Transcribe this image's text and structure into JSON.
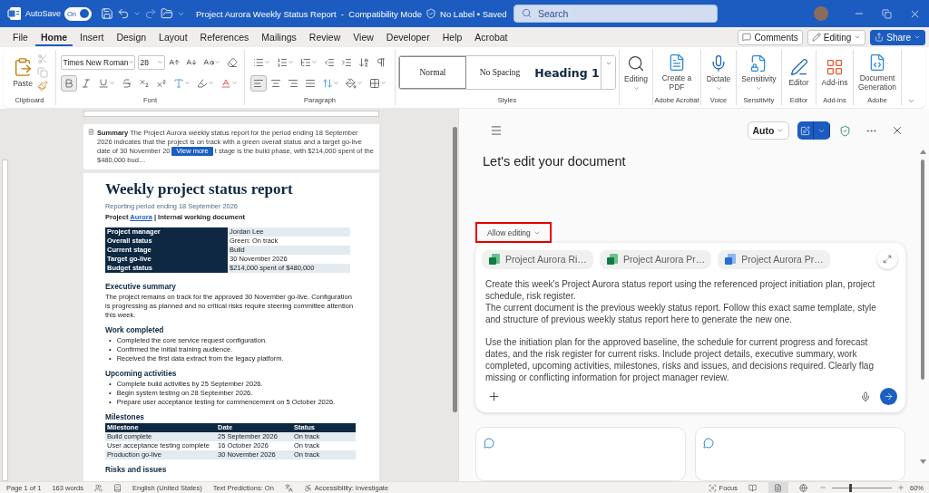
{
  "title_bar": {
    "autosave_label": "AutoSave",
    "autosave_toggle": {
      "label": "On",
      "on": true
    },
    "title": "Project Aurora Weekly Status Report  -  Compatibility Mode",
    "status": "No Label • Saved",
    "search_placeholder": "Search"
  },
  "menu_tabs": [
    {
      "label": "File",
      "selected": false
    },
    {
      "label": "Home",
      "selected": true
    },
    {
      "label": "Insert",
      "selected": false
    },
    {
      "label": "Design",
      "selected": false
    },
    {
      "label": "Layout",
      "selected": false
    },
    {
      "label": "References",
      "selected": false
    },
    {
      "label": "Mailings",
      "selected": false
    },
    {
      "label": "Review",
      "selected": false
    },
    {
      "label": "View",
      "selected": false
    },
    {
      "label": "Developer",
      "selected": false
    },
    {
      "label": "Help",
      "selected": false
    },
    {
      "label": "Acrobat",
      "selected": false
    }
  ],
  "header_actions": {
    "comments": "Comments",
    "editing": "Editing",
    "share": "Share"
  },
  "ribbon": {
    "clipboard": {
      "label": "Clipboard",
      "paste": "Paste",
      "tools": [
        {
          "kind": "cut",
          "disabled": true
        },
        {
          "kind": "copy",
          "disabled": true
        },
        {
          "kind": "format-painter",
          "disabled": false
        }
      ]
    },
    "font": {
      "label": "Font",
      "font_name": "Times New Roman",
      "font_size": "28",
      "row_1": [
        {
          "kind": "grow",
          "caret": false
        },
        {
          "kind": "shrink",
          "caret": false
        },
        {
          "kind": "change-case",
          "caret": true
        },
        {
          "kind": "clear-formatting",
          "caret": false
        }
      ],
      "row_2": [
        {
          "kind": "bold",
          "caret": false,
          "selected": true
        },
        {
          "kind": "italic",
          "caret": false,
          "selected": false
        },
        {
          "kind": "underline",
          "caret": true,
          "selected": false
        },
        {
          "kind": "strikethrough",
          "caret": false,
          "selected": false
        },
        {
          "kind": "subscript",
          "caret": false,
          "selected": false
        },
        {
          "kind": "superscript",
          "caret": false,
          "selected": false
        },
        {
          "kind": "text-effects",
          "caret": true,
          "selected": false
        },
        {
          "kind": "highlight",
          "caret": true,
          "selected": false
        },
        {
          "kind": "font-color",
          "caret": true,
          "selected": false
        }
      ]
    },
    "paragraph": {
      "label": "Paragraph",
      "row_1": [
        {
          "kind": "bullets",
          "caret": true
        },
        {
          "kind": "numbering",
          "caret": true
        },
        {
          "kind": "multilevel",
          "caret": true
        },
        {
          "kind": "decrease-indent",
          "caret": false
        },
        {
          "kind": "increase-indent",
          "caret": false
        },
        {
          "kind": "sort",
          "caret": false
        },
        {
          "kind": "show-marks",
          "caret": false
        }
      ],
      "row_2": [
        {
          "kind": "align-left",
          "caret": false,
          "selected": true
        },
        {
          "kind": "align-center",
          "caret": false,
          "selected": false
        },
        {
          "kind": "align-right",
          "caret": false,
          "selected": false
        },
        {
          "kind": "justify",
          "caret": false,
          "selected": false
        },
        {
          "kind": "line-spacing",
          "caret": true,
          "selected": false
        },
        {
          "kind": "shading",
          "caret": true,
          "selected": false
        },
        {
          "kind": "borders",
          "caret": true,
          "selected": false
        }
      ]
    },
    "styles": {
      "label": "Styles",
      "items": [
        {
          "kind": "normal",
          "label": "Normal",
          "selected": true
        },
        {
          "kind": "plain",
          "label": "No Spacing",
          "selected": false
        },
        {
          "kind": "heading",
          "label": "Heading 1",
          "selected": false
        }
      ]
    },
    "commands": [
      {
        "kind": "search",
        "label": "Editing",
        "caret": true
      },
      {
        "kind": "pdf",
        "label": "Create a PDF",
        "group": "Adobe Acrobat",
        "caret": false
      },
      {
        "kind": "mic",
        "label": "Dictate",
        "group": "Voice",
        "caret": true
      },
      {
        "kind": "sensitivity",
        "label": "Sensitivity",
        "group": "Sensitivity",
        "caret": true
      },
      {
        "kind": "editor",
        "label": "Editor",
        "group": "Editor",
        "caret": false
      },
      {
        "kind": "add-ins",
        "label": "Add-ins",
        "group": "Add-ins",
        "caret": false
      },
      {
        "kind": "doc-gen",
        "label": "Document Generation",
        "group": "Adobe",
        "caret": false
      }
    ]
  },
  "document": {
    "summary": {
      "label": "Summary",
      "line_1": "The Project Aurora weekly status report for the period ending 18 September 2026 indicates that the project is on track with a green",
      "line_2_start": "overall status and a target go-live date of 30 November 20",
      "button": "View more",
      "line_2_end": "t stage is the build phase, with $214,000 spent of the $480,000 bud…"
    },
    "title": "Weekly project status report",
    "subtitle": "Reporting period ending 18 September 2026",
    "project_line": {
      "before": "Project",
      "highlighted": "Aurora",
      "after": "|  Internal working document"
    },
    "details": [
      [
        "Project manager",
        "Jordan Lee"
      ],
      [
        "Overall status",
        "Green: On track"
      ],
      [
        "Current stage",
        "Build"
      ],
      [
        "Target go-live",
        "30 November 2026"
      ],
      [
        "Budget status",
        "$214,000 spent of $480,000"
      ]
    ],
    "executive_summary": {
      "heading": "Executive summary",
      "text": "The project remains on track for the approved 30 November go-live. Configuration is progressing as planned and no critical risks require steering committee attention this week."
    },
    "work_completed": {
      "heading": "Work completed",
      "marker": "•",
      "items": [
        "Completed the core service request configuration.",
        "Confirmed the initial training audience.",
        "Received the first data extract from the legacy platform."
      ]
    },
    "upcoming": {
      "heading": "Upcoming activities",
      "marker": "•",
      "items": [
        "Complete build activities by 25 September 2026.",
        "Begin system testing on 28 September 2026.",
        "Prepare user acceptance testing for commencement on 5 October 2026."
      ]
    },
    "milestones": {
      "heading": "Milestones",
      "columns": [
        "Milestone",
        "Date",
        "Status"
      ],
      "rows": [
        [
          "Build complete",
          "25 September 2026",
          "On track"
        ],
        [
          "User acceptance testing complete",
          "16 October 2026",
          "On track"
        ],
        [
          "Production go-live",
          "30 November 2026",
          "On track"
        ]
      ]
    },
    "risks": {
      "heading": "Risks and issues"
    }
  },
  "copilot": {
    "mode": "Auto",
    "heading": "Let's edit your document",
    "allow_editing": "Allow editing",
    "attachments": [
      {
        "kind": "spreadsheet",
        "name": "Project Aurora Ri…"
      },
      {
        "kind": "spreadsheet",
        "name": "Project Aurora Pr…"
      },
      {
        "kind": "project",
        "name": "Project Aurora Pr…"
      }
    ],
    "prompt_blocks": [
      [
        "Create this week's Project Aurora status report using the referenced project initiation plan, project schedule, risk register.",
        "The current document is the previous weekly status report. Follow this exact same template, style and structure of previous weekly status report here to generate the new one."
      ],
      [
        "Use the initiation plan for the approved baseline, the schedule for current progress and forecast dates, and the risk register for current risks. Include project details, executive summary, work completed, upcoming activities, milestones, risks and issues, and decisions required. Clearly flag missing or conflicting information for project manager review."
      ]
    ]
  },
  "status_bar": {
    "page": "Page 1 of 1",
    "words": "163 words",
    "language": "English (United States)",
    "predictions": "Text Predictions: On",
    "accessibility": "Accessibility: Investigate",
    "focus": "Focus",
    "views": [
      {
        "kind": "read",
        "selected": false
      },
      {
        "kind": "print",
        "selected": true
      },
      {
        "kind": "web",
        "selected": false
      }
    ],
    "zoom": {
      "level": 0.3,
      "label": "60%"
    }
  }
}
